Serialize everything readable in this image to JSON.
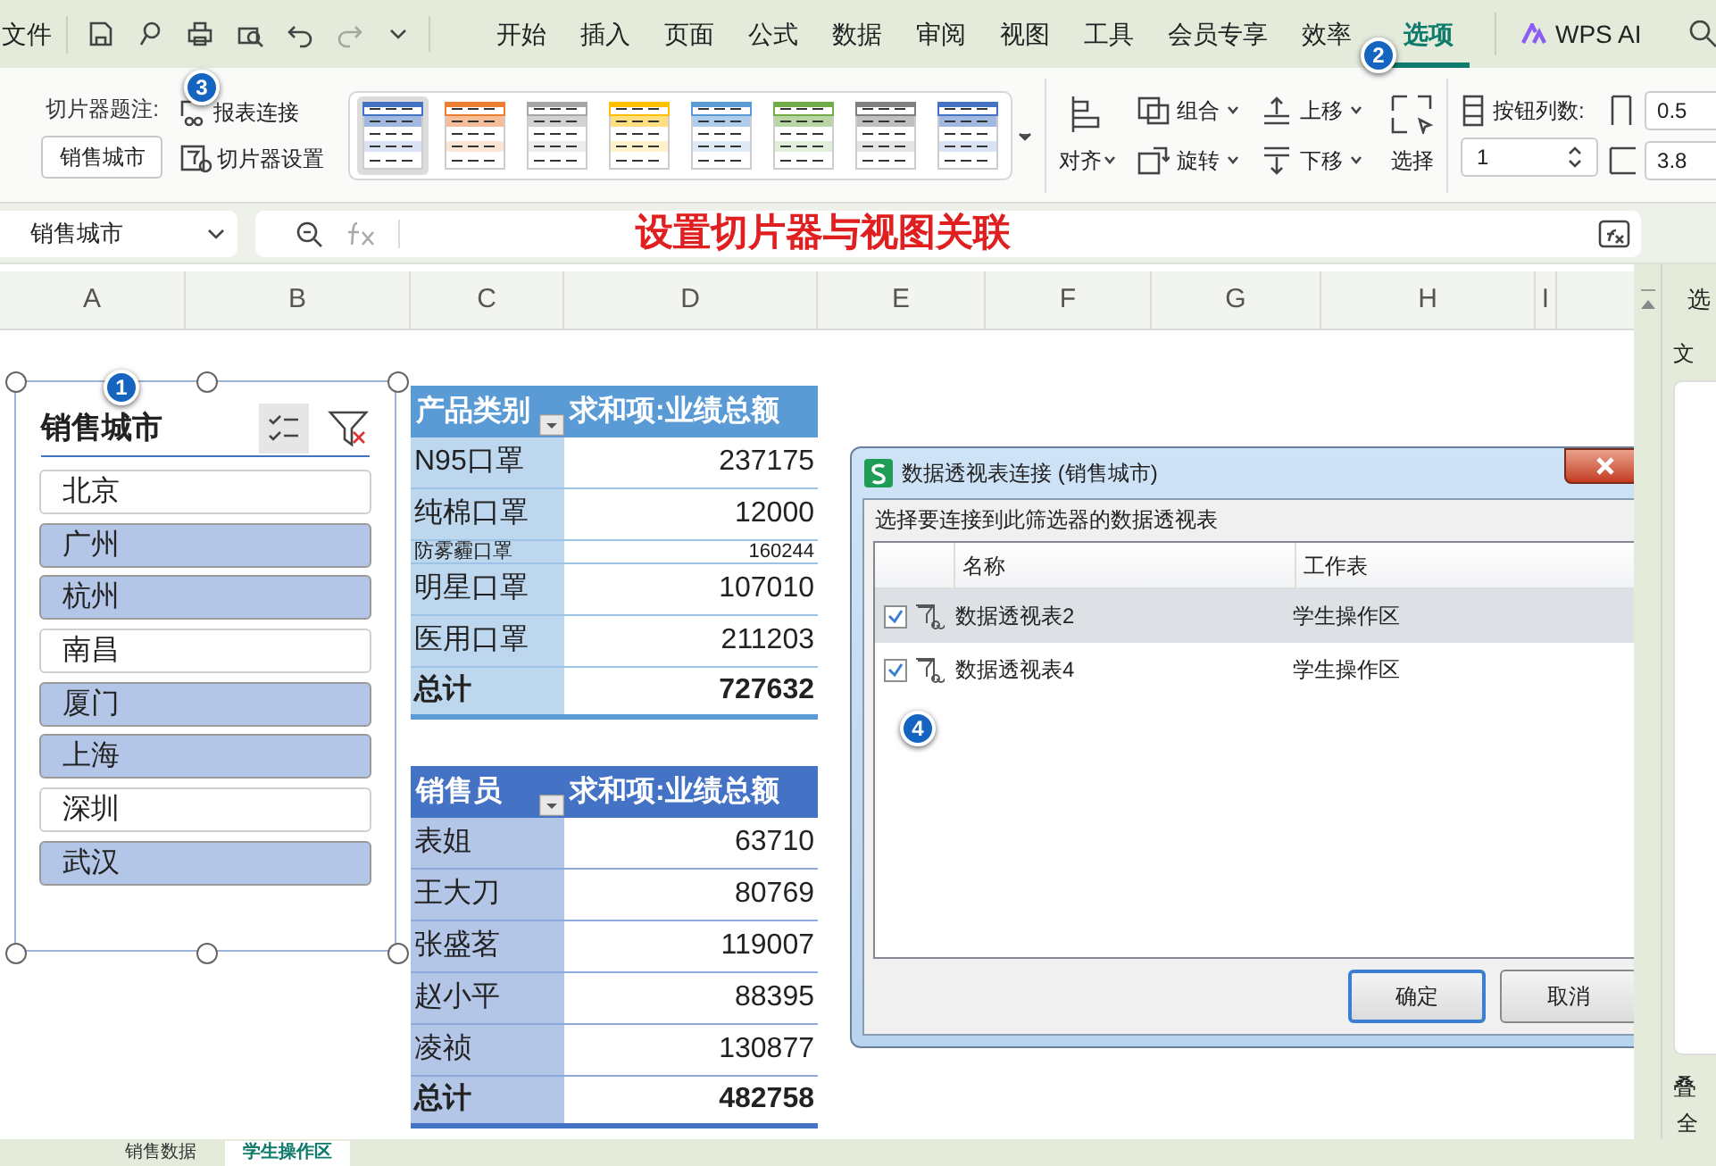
{
  "title_bar": {
    "file_menu": "文件"
  },
  "menu_tabs": [
    {
      "label": "开始",
      "selected": false
    },
    {
      "label": "插入",
      "selected": false
    },
    {
      "label": "页面",
      "selected": false
    },
    {
      "label": "公式",
      "selected": false
    },
    {
      "label": "数据",
      "selected": false
    },
    {
      "label": "审阅",
      "selected": false
    },
    {
      "label": "视图",
      "selected": false
    },
    {
      "label": "工具",
      "selected": false
    },
    {
      "label": "会员专享",
      "selected": false
    },
    {
      "label": "效率",
      "selected": false
    },
    {
      "label": "选项",
      "selected": true
    }
  ],
  "ai_button": "WPS AI",
  "ribbon": {
    "caption_label": "切片器题注:",
    "caption_value": "销售城市",
    "report_connections": "报表连接",
    "slicer_settings": "切片器设置",
    "styles": [
      {
        "color": "#4472c4",
        "selected": true
      },
      {
        "color": "#ed7d31",
        "selected": false
      },
      {
        "color": "#a5a5a5",
        "selected": false
      },
      {
        "color": "#ffc000",
        "selected": false
      },
      {
        "color": "#5b9bd5",
        "selected": false
      },
      {
        "color": "#70ad47",
        "selected": false
      },
      {
        "color": "#7f7f7f",
        "selected": false
      },
      {
        "color": "#4472c4",
        "selected": false
      }
    ],
    "align": "对齐",
    "group": "组合",
    "rotate": "旋转",
    "bring_forward": "上移",
    "send_backward": "下移",
    "select": "选择",
    "columns_label": "按钮列数:",
    "columns_value": "1",
    "height_value": "0.5",
    "width_value": "3.8"
  },
  "name_box": "销售城市",
  "annotation": "设置切片器与视图关联",
  "column_headers": [
    "A",
    "B",
    "C",
    "D",
    "E",
    "F",
    "G",
    "H",
    "I"
  ],
  "callouts": [
    "1",
    "2",
    "3",
    "4"
  ],
  "slicer": {
    "title": "销售城市",
    "items": [
      {
        "label": "北京",
        "selected": false
      },
      {
        "label": "广州",
        "selected": true
      },
      {
        "label": "杭州",
        "selected": true
      },
      {
        "label": "南昌",
        "selected": false
      },
      {
        "label": "厦门",
        "selected": true
      },
      {
        "label": "上海",
        "selected": true
      },
      {
        "label": "深圳",
        "selected": false
      },
      {
        "label": "武汉",
        "selected": true
      }
    ]
  },
  "pivot_tables": [
    {
      "columns": [
        "产品类别",
        "求和项:业绩总额"
      ],
      "rows": [
        {
          "label": "N95口罩",
          "value": "237175",
          "clipped": false
        },
        {
          "label": "纯棉口罩",
          "value": "12000",
          "clipped": false
        },
        {
          "label": "防雾霾口罩",
          "value": "160244",
          "clipped": true
        },
        {
          "label": "明星口罩",
          "value": "107010",
          "clipped": false
        },
        {
          "label": "医用口罩",
          "value": "211203",
          "clipped": false
        }
      ],
      "total_label": "总计",
      "total_value": "727632"
    },
    {
      "columns": [
        "销售员",
        "求和项:业绩总额"
      ],
      "rows": [
        {
          "label": "表姐",
          "value": "63710",
          "clipped": false
        },
        {
          "label": "王大刀",
          "value": "80769",
          "clipped": false
        },
        {
          "label": "张盛茗",
          "value": "119007",
          "clipped": false
        },
        {
          "label": "赵小平",
          "value": "88395",
          "clipped": false
        },
        {
          "label": "凌祯",
          "value": "130877",
          "clipped": false
        }
      ],
      "total_label": "总计",
      "total_value": "482758"
    }
  ],
  "dialog": {
    "title": "数据透视表连接 (销售城市)",
    "prompt": "选择要连接到此筛选器的数据透视表",
    "columns": [
      "名称",
      "工作表"
    ],
    "rows": [
      {
        "name": "数据透视表2",
        "sheet": "学生操作区",
        "checked": true,
        "selected": true
      },
      {
        "name": "数据透视表4",
        "sheet": "学生操作区",
        "checked": true,
        "selected": false
      }
    ],
    "buttons": [
      {
        "label": "确定",
        "default": true
      },
      {
        "label": "取消",
        "default": false
      }
    ]
  },
  "side_panel": [
    "选",
    "文",
    "叠",
    "全"
  ],
  "sheet_tabs": [
    {
      "label": "销售数据",
      "selected": false
    },
    {
      "label": "学生操作区",
      "selected": true
    }
  ]
}
